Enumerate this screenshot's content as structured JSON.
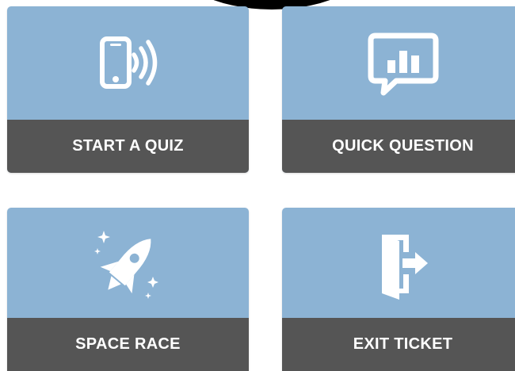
{
  "tiles": [
    {
      "label": "START A QUIZ",
      "icon": "phone-signal-icon"
    },
    {
      "label": "QUICK QUESTION",
      "icon": "chat-bar-chart-icon"
    },
    {
      "label": "SPACE RACE",
      "icon": "rocket-icon"
    },
    {
      "label": "EXIT TICKET",
      "icon": "exit-door-icon"
    }
  ],
  "colors": {
    "tile_bg": "#8cb3d4",
    "label_bg": "#555555",
    "label_text": "#ffffff"
  }
}
